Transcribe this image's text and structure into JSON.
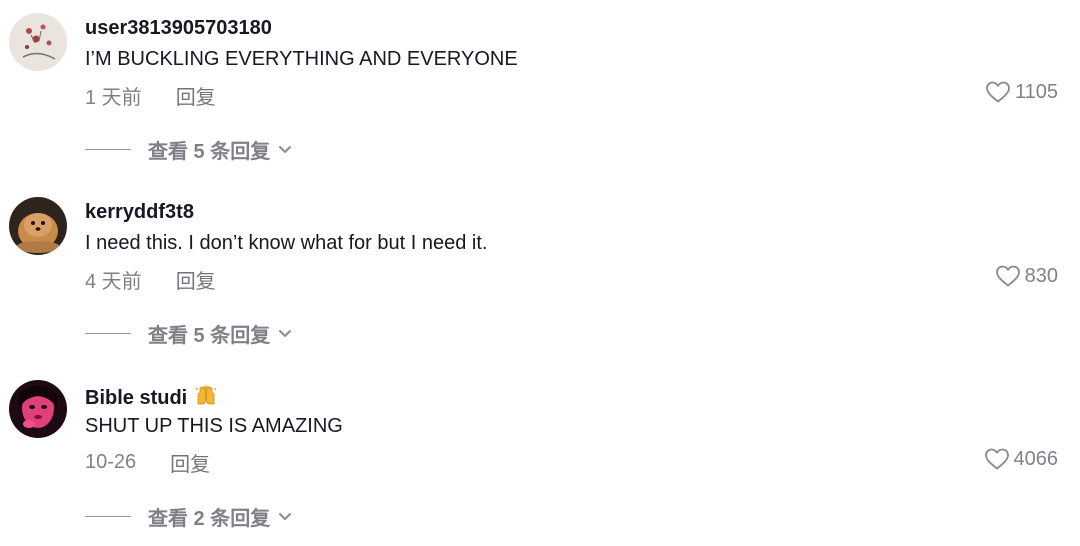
{
  "comments": [
    {
      "username": "user3813905703180",
      "text": "I’M BUCKLING EVERYTHING AND EVERYONE",
      "time": "1 天前",
      "reply": "回复",
      "likes": "1105",
      "view_replies": "查看 5 条回复"
    },
    {
      "username": "kerryddf3t8",
      "text": "I need this. I don’t know what for but I need it.",
      "time": "4 天前",
      "reply": "回复",
      "likes": "830",
      "view_replies": "查看 5 条回复"
    },
    {
      "username": "Bible studi",
      "emoji": "🙌",
      "text": "SHUT UP THIS IS AMAZING",
      "time": "10-26",
      "reply": "回复",
      "likes": "4066",
      "view_replies": "查看 2 条回复"
    }
  ],
  "icons": {
    "like": "heart-outline-icon",
    "expand": "chevron-down-icon",
    "emoji": "raising-hands-emoji"
  },
  "colors": {
    "primary_text": "#161823",
    "secondary_text": "#8a8b91",
    "emoji_yellow": "#f5b731"
  }
}
